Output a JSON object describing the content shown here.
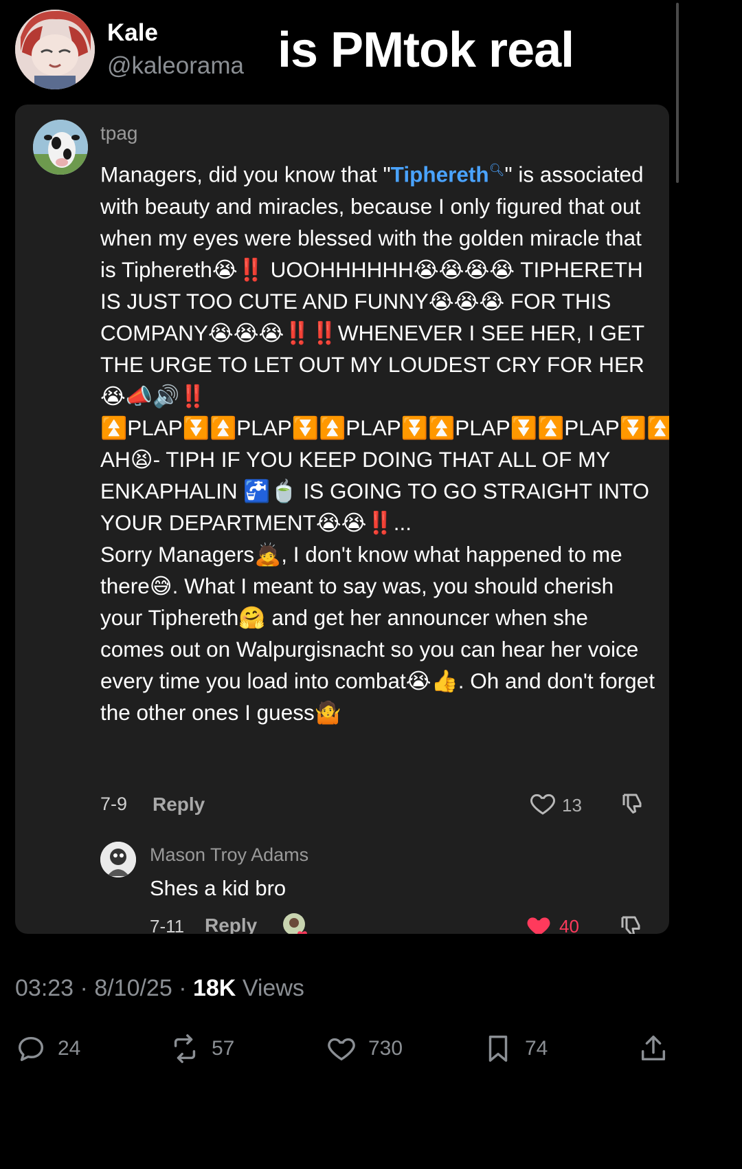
{
  "post": {
    "author_name": "Kale",
    "author_handle": "@kaleorama",
    "text": "is PMtok real",
    "time": "03:23",
    "date": "8/10/25",
    "views_count": "18K",
    "views_label": "Views",
    "stats": {
      "replies": "24",
      "reposts": "57",
      "likes": "730",
      "bookmarks": "74"
    }
  },
  "comment": {
    "username": "tpag",
    "body_prefix": "Managers, did you know that \"",
    "search_term": "Tiphereth",
    "body_suffix": "\" is associated with beauty and miracles, because I only figured that out when my eyes were blessed with the golden miracle that is Tiphereth😭‼️ UOOHHHHHH😭😭😭😭 TIPHERETH IS JUST TOO CUTE AND FUNNY😭😭😭 FOR THIS COMPANY😭😭😭‼️‼️WHENEVER I SEE HER, I GET THE URGE TO LET OUT MY LOUDEST CRY FOR HER😭📣🔊‼️\n⏫PLAP⏬⏫PLAP⏬⏫PLAP⏬⏫PLAP⏬⏫PLAP⏬⏫PLAP⏬⏫PLAP⏬ AH😫- TIPH IF YOU KEEP DOING THAT ALL OF MY ENKAPHALIN 🚰🍵 IS GOING TO GO STRAIGHT INTO YOUR DEPARTMENT😭😭‼️...\nSorry Managers🙇, I don't know what happened to me there😅. What I meant to say was, you should cherish your Tiphereth🤗 and get her announcer when she comes out on Walpurgisnacht so you can hear her voice every time you load into combat😭👍. Oh and don't forget the other ones I guess🤷",
    "date": "7-9",
    "reply_label": "Reply",
    "likes": "13"
  },
  "reply": {
    "username": "Mason Troy Adams",
    "text": "Shes a kid bro",
    "date": "7-11",
    "reply_label": "Reply",
    "likes": "40"
  },
  "colors": {
    "background": "#000000",
    "card": "#1f1f1f",
    "link": "#4aa3ff",
    "liked": "#ff3a5c",
    "muted": "#8b8f94"
  },
  "icons": [
    "search-icon",
    "heart-icon",
    "dislike-icon",
    "reply-icon",
    "repost-icon",
    "bookmark-icon",
    "share-icon"
  ]
}
